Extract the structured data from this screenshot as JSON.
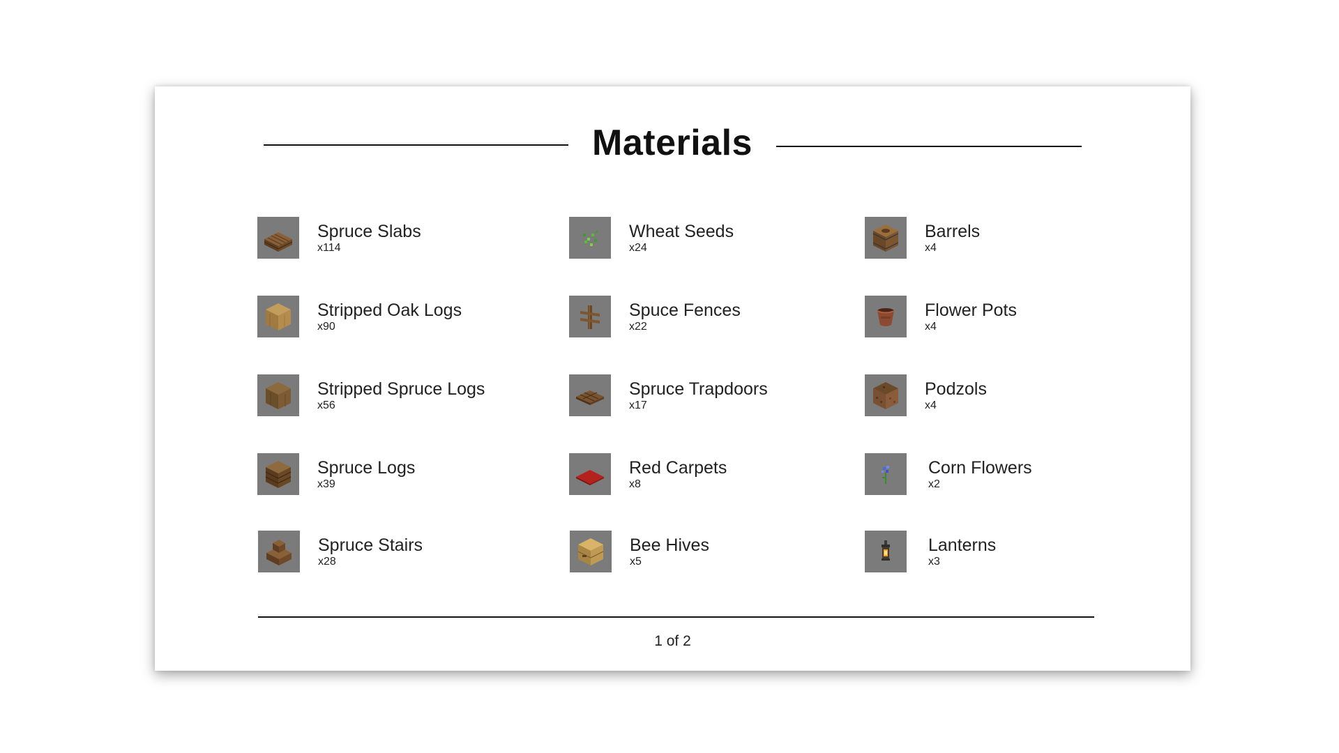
{
  "title": "Materials",
  "items": [
    {
      "name": "Spruce Slabs",
      "qty": "x114",
      "icon": "spruce-slab-icon"
    },
    {
      "name": "Stripped Oak Logs",
      "qty": "x90",
      "icon": "stripped-oak-log-icon"
    },
    {
      "name": "Stripped Spruce Logs",
      "qty": "x56",
      "icon": "stripped-spruce-log-icon"
    },
    {
      "name": "Spruce Logs",
      "qty": "x39",
      "icon": "spruce-log-icon"
    },
    {
      "name": "Spruce Stairs",
      "qty": "x28",
      "icon": "spruce-stairs-icon"
    },
    {
      "name": "Wheat Seeds",
      "qty": "x24",
      "icon": "wheat-seeds-icon"
    },
    {
      "name": "Spuce Fences",
      "qty": "x22",
      "icon": "spruce-fence-icon"
    },
    {
      "name": "Spruce Trapdoors",
      "qty": "x17",
      "icon": "spruce-trapdoor-icon"
    },
    {
      "name": "Red Carpets",
      "qty": "x8",
      "icon": "red-carpet-icon"
    },
    {
      "name": "Bee Hives",
      "qty": "x5",
      "icon": "bee-hive-icon"
    },
    {
      "name": "Barrels",
      "qty": "x4",
      "icon": "barrel-icon"
    },
    {
      "name": "Flower Pots",
      "qty": "x4",
      "icon": "flower-pot-icon"
    },
    {
      "name": "Podzols",
      "qty": "x4",
      "icon": "podzol-icon"
    },
    {
      "name": "Corn Flowers",
      "qty": "x2",
      "icon": "cornflower-icon"
    },
    {
      "name": "Lanterns",
      "qty": "x3",
      "icon": "lantern-icon"
    }
  ],
  "pager": "1 of 2"
}
